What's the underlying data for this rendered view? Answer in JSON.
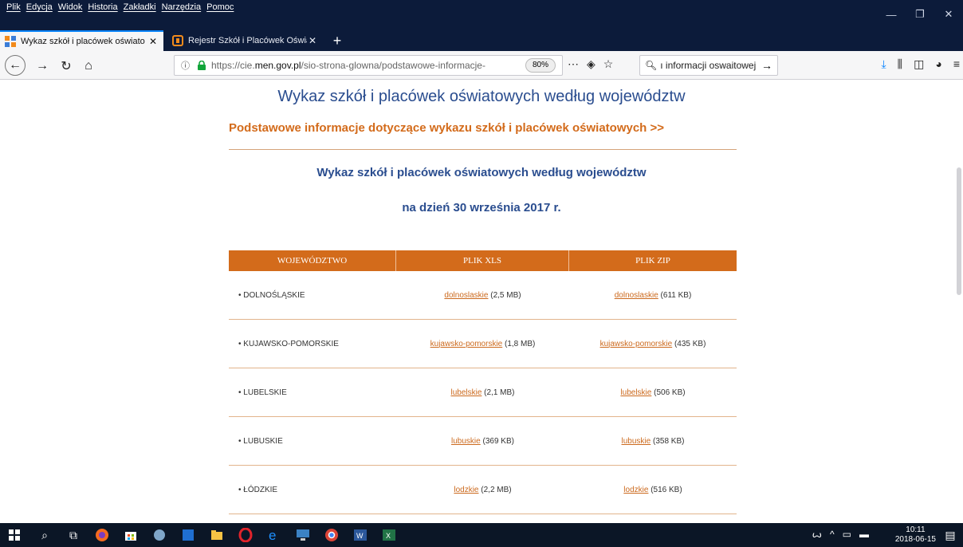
{
  "menubar": {
    "items": [
      "Plik",
      "Edycja",
      "Widok",
      "Historia",
      "Zakładki",
      "Narzędzia",
      "Pomoc"
    ]
  },
  "window_controls": {
    "minimize": "—",
    "restore": "❐",
    "close": "✕"
  },
  "tabs": [
    {
      "title": "Wykaz szkół i placówek oświato",
      "close": "✕"
    },
    {
      "title": "Rejestr Szkół i Placówek Oświat",
      "close": "✕"
    }
  ],
  "newtab": "+",
  "nav": {
    "url_domain_prefix": "https://cie.",
    "url_domain": "men.gov.pl",
    "url_path": "/sio-strona-glowna/podstawowe-informacje-",
    "zoom": "80%",
    "search_text": "ı informacji oswaitowej"
  },
  "content": {
    "h1": "Wykaz szkół i placówek oświatowych według województw",
    "h2": "Podstawowe informacje dotyczące wykazu szkół i placówek oświatowych >>",
    "h3": "Wykaz szkół i placówek oświatowych według województw",
    "h4": "na dzień 30 września 2017 r."
  },
  "table": {
    "headers": [
      "WOJEWÓDZTWO",
      "PLIK XLS",
      "PLIK ZIP"
    ],
    "rows": [
      {
        "name": "DOLNOŚLĄSKIE",
        "xls_link": "dolnoslaskie",
        "xls_size": "(2,5 MB)",
        "zip_link": "dolnoslaskie",
        "zip_size": "(611 KB)"
      },
      {
        "name": "KUJAWSKO-POMORSKIE",
        "xls_link": "kujawsko-pomorskie",
        "xls_size": "(1,8 MB)",
        "zip_link": "kujawsko-pomorskie",
        "zip_size": "(435 KB)"
      },
      {
        "name": "LUBELSKIE",
        "xls_link": "lubelskie",
        "xls_size": "(2,1 MB)",
        "zip_link": "lubelskie",
        "zip_size": "(506 KB)"
      },
      {
        "name": "LUBUSKIE",
        "xls_link": "lubuskie",
        "xls_size": "(369 KB)",
        "zip_link": "lubuskie",
        "zip_size": "(358 KB)"
      },
      {
        "name": "ŁÓDZKIE",
        "xls_link": "lodzkie",
        "xls_size": "(2,2 MB)",
        "zip_link": "lodzkie",
        "zip_size": "(516 KB)"
      }
    ]
  },
  "taskbar": {
    "time": "10:11",
    "date": "2018-06-15"
  },
  "colors": {
    "accent_orange": "#d36b1b",
    "heading_blue": "#2a4d8f",
    "titlebar": "#0c1b3a"
  }
}
